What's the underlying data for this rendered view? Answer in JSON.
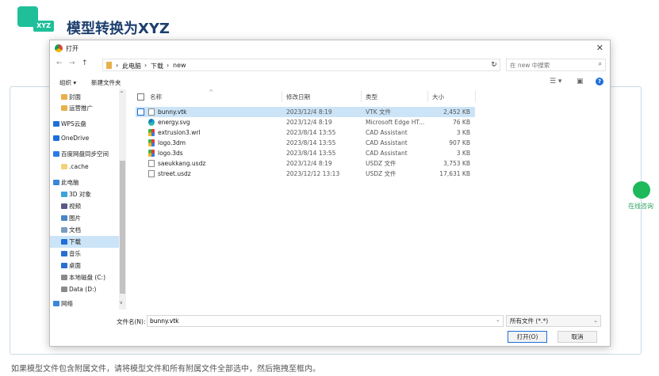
{
  "header": {
    "logo_tag": "XYZ",
    "title": "模型转换为XYZ"
  },
  "hint": "如果模型文件包含附属文件，请将模型文件和所有附属文件全部选中，然后拖拽至框内。",
  "wechat_label": "在线咨询",
  "dialog": {
    "title": "打开",
    "close_glyph": "✕",
    "nav": {
      "back": "←",
      "forward": "→",
      "up": "↑"
    },
    "breadcrumb": [
      "此电脑",
      "下载",
      "new"
    ],
    "crumb_sep": "›",
    "refresh_glyph": "↻",
    "search_placeholder": "在 new 中搜索",
    "search_glyph": "⌕",
    "toolbar": {
      "organize": "组织 ▾",
      "new_folder": "新建文件夹",
      "view_glyph": "☰ ▾",
      "pane_glyph": "▣",
      "help": "?"
    },
    "sidebar": [
      {
        "label": "封面",
        "icon": "folder-icon",
        "color": "#e8b04b"
      },
      {
        "label": "运营推广",
        "icon": "folder-icon",
        "color": "#e8b04b"
      },
      {
        "label": "WPS云盘",
        "icon": "cloud-icon",
        "color": "#1e6fd9"
      },
      {
        "label": "OneDrive",
        "icon": "cloud-icon",
        "color": "#1e6fd9"
      },
      {
        "label": "百度网盘同步空间",
        "icon": "baidu-icon",
        "color": "#2a7be4"
      },
      {
        "label": ".cache",
        "icon": "folder-icon",
        "color": "#f2d37a"
      },
      {
        "label": "此电脑",
        "icon": "computer-icon",
        "color": "#3a88d8"
      },
      {
        "label": "3D 对象",
        "icon": "cube-icon",
        "color": "#3da3d8"
      },
      {
        "label": "视频",
        "icon": "video-icon",
        "color": "#5a5a8a"
      },
      {
        "label": "图片",
        "icon": "picture-icon",
        "color": "#4a86c8"
      },
      {
        "label": "文档",
        "icon": "document-icon",
        "color": "#7a9cc0"
      },
      {
        "label": "下载",
        "icon": "download-icon",
        "color": "#1e6fd9"
      },
      {
        "label": "音乐",
        "icon": "music-icon",
        "color": "#2a6fd0"
      },
      {
        "label": "桌面",
        "icon": "desktop-icon",
        "color": "#2a6fd0"
      },
      {
        "label": "本地磁盘 (C:)",
        "icon": "drive-icon",
        "color": "#8a8a8a"
      },
      {
        "label": "Data (D:)",
        "icon": "drive-icon",
        "color": "#8a8a8a"
      },
      {
        "label": "网络",
        "icon": "network-icon",
        "color": "#3a88d8"
      }
    ],
    "sidebar_selected": "下载",
    "columns": {
      "name": "名称",
      "date": "修改日期",
      "type": "类型",
      "size": "大小",
      "sort_glyph": "^"
    },
    "files": [
      {
        "name": "bunny.vtk",
        "date": "2023/12/4 8:19",
        "type": "VTK 文件",
        "size": "2,452 KB",
        "icon": "document-icon",
        "selected": true
      },
      {
        "name": "energy.svg",
        "date": "2023/12/4 8:19",
        "type": "Microsoft Edge HT...",
        "size": "76 KB",
        "icon": "edge-icon",
        "selected": false
      },
      {
        "name": "extrusion3.wrl",
        "date": "2023/8/14 13:55",
        "type": "CAD Assistant",
        "size": "3 KB",
        "icon": "cad-assistant-icon",
        "selected": false
      },
      {
        "name": "logo.3dm",
        "date": "2023/8/14 13:55",
        "type": "CAD Assistant",
        "size": "907 KB",
        "icon": "cad-assistant-icon",
        "selected": false
      },
      {
        "name": "logo.3ds",
        "date": "2023/8/14 13:55",
        "type": "CAD Assistant",
        "size": "3 KB",
        "icon": "cad-assistant-icon",
        "selected": false
      },
      {
        "name": "saeukkang.usdz",
        "date": "2023/12/4 8:19",
        "type": "USDZ 文件",
        "size": "3,753 KB",
        "icon": "document-icon",
        "selected": false
      },
      {
        "name": "street.usdz",
        "date": "2023/12/12 13:13",
        "type": "USDZ 文件",
        "size": "17,631 KB",
        "icon": "document-icon",
        "selected": false
      }
    ],
    "filename_label": "文件名(N):",
    "filename_value": "bunny.vtk",
    "filetype_value": "所有文件 (*.*)",
    "open_button": "打开(O)",
    "cancel_button": "取消"
  }
}
